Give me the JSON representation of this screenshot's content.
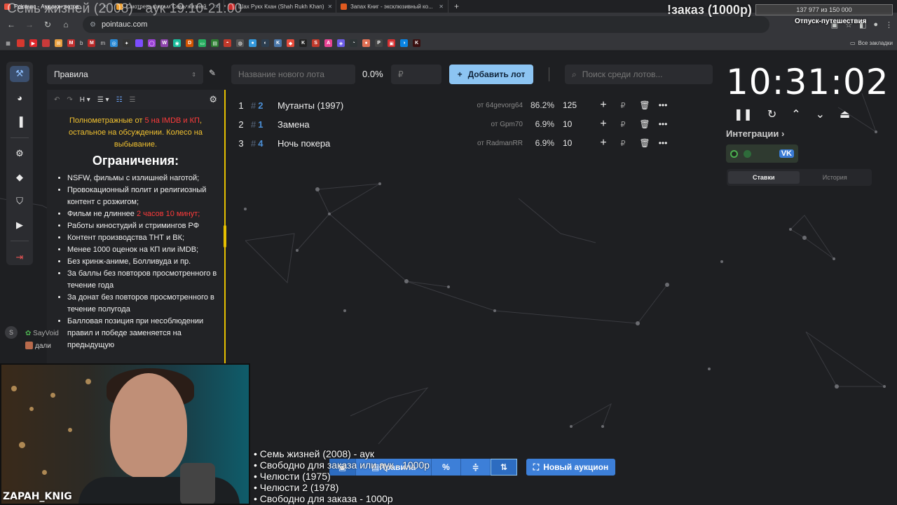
{
  "overlay": {
    "title": "Семь жизней (2008) - аук 19:10-21:00",
    "order": "!заказ (1000р)",
    "progress_text": "137 977 из 150 000",
    "progress_fraction": 0.92,
    "goal": "Отпуск-путешествия"
  },
  "browser": {
    "tabs": [
      {
        "label": "Pointauc - Аукцион лотов",
        "color": "#e8523f"
      },
      {
        "label": "Смотреть фильм Семь жизней",
        "color": "#f0a030"
      },
      {
        "label": "Шах Рукх Кхан (Shah Rukh Khan)",
        "color": "#cc2a2a"
      },
      {
        "label": "Запах Книг - эксклюзивный ко...",
        "color": "#e05a1f"
      }
    ],
    "url": "pointauc.com",
    "bookmarks_all": "Все закладки",
    "bm_labels": [
      "b",
      "m"
    ]
  },
  "editor": {
    "select_label": "Правила",
    "intro_a": "Полнометражные от ",
    "intro_red": "5 на IMDB и КП",
    "intro_b": ", остальное на обсуждении. Колесо на выбывание.",
    "heading": "Ограничения:",
    "rules": [
      "NSFW, фильмы с излишней наготой;",
      "Провокационный полит и религиозный контент с розжигом;",
      "Фильм не длиннее ",
      "Работы киностудий и стримингов РФ",
      "Контент производства ТНТ и ВК;",
      "Менее 1000 оценок на КП или iMDB;",
      "Без кринж-аниме, Болливуда и пр.",
      "За баллы без повторов просмотренного в течение года",
      "За донат без повторов просмотренного в течение полугода",
      "Балловая позиция при несоблюдении правил и победе заменяется на предыдущую"
    ],
    "rule3_red": "2 часов 10 минут;"
  },
  "chat": {
    "avatar_letter": "S",
    "user1": "SayVoid",
    "user2": "дали"
  },
  "lot_form": {
    "name_placeholder": "Название нового лота",
    "percent": "0.0%",
    "amount_placeholder": "₽",
    "add_label": "Добавить лот",
    "search_placeholder": "Поиск среди лотов..."
  },
  "lots": [
    {
      "num": "1",
      "id": "2",
      "name": "Мутанты (1997)",
      "from": "от 64gevorg64",
      "pct": "86.2%",
      "amount": "125"
    },
    {
      "num": "2",
      "id": "1",
      "name": "Замена",
      "from": "от Gpm70",
      "pct": "6.9%",
      "amount": "10"
    },
    {
      "num": "3",
      "id": "4",
      "name": "Ночь покера",
      "from": "от RadmanRR",
      "pct": "6.9%",
      "amount": "10"
    }
  ],
  "timer": {
    "time": "10:31:02",
    "integrations_label": "Интеграции",
    "vk_label": "VK",
    "tab_bets": "Ставки",
    "tab_history": "История"
  },
  "stream": {
    "channel": "ZAPAH_KNIG",
    "queue": [
      "• Семь жизней (2008) - аук",
      "• Свободно для заказа или аук - 1000р",
      "• Челюсти (1975)",
      "• Челюсти 2 (1978)",
      "• Свободно для заказа - 1000р"
    ]
  },
  "bottom": {
    "rules_label": "Правила",
    "new_auction": "Новый аукцион"
  },
  "colors": {
    "accent": "#8cc4f2",
    "rules_border": "#e6c000",
    "warning_text": "#f2c230",
    "danger_text": "#ff3b3b",
    "bottom_button": "#3d7fd8"
  }
}
